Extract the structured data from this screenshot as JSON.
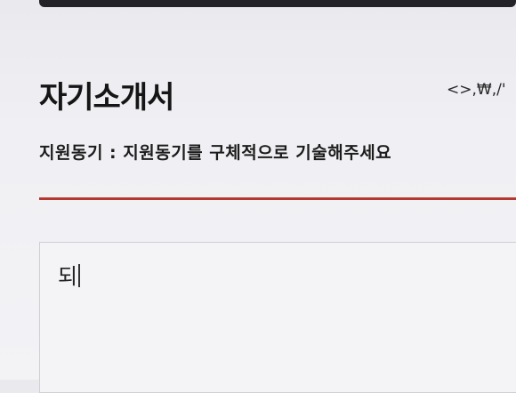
{
  "section": {
    "title": "자기소개서",
    "char_hint": "<>,₩,/'"
  },
  "question": {
    "label": "지원동기 : 지원동기를 구체적으로 기술해주세요"
  },
  "answer": {
    "value": "되"
  },
  "colors": {
    "divider": "#b3382f",
    "top_bar": "#242428"
  }
}
